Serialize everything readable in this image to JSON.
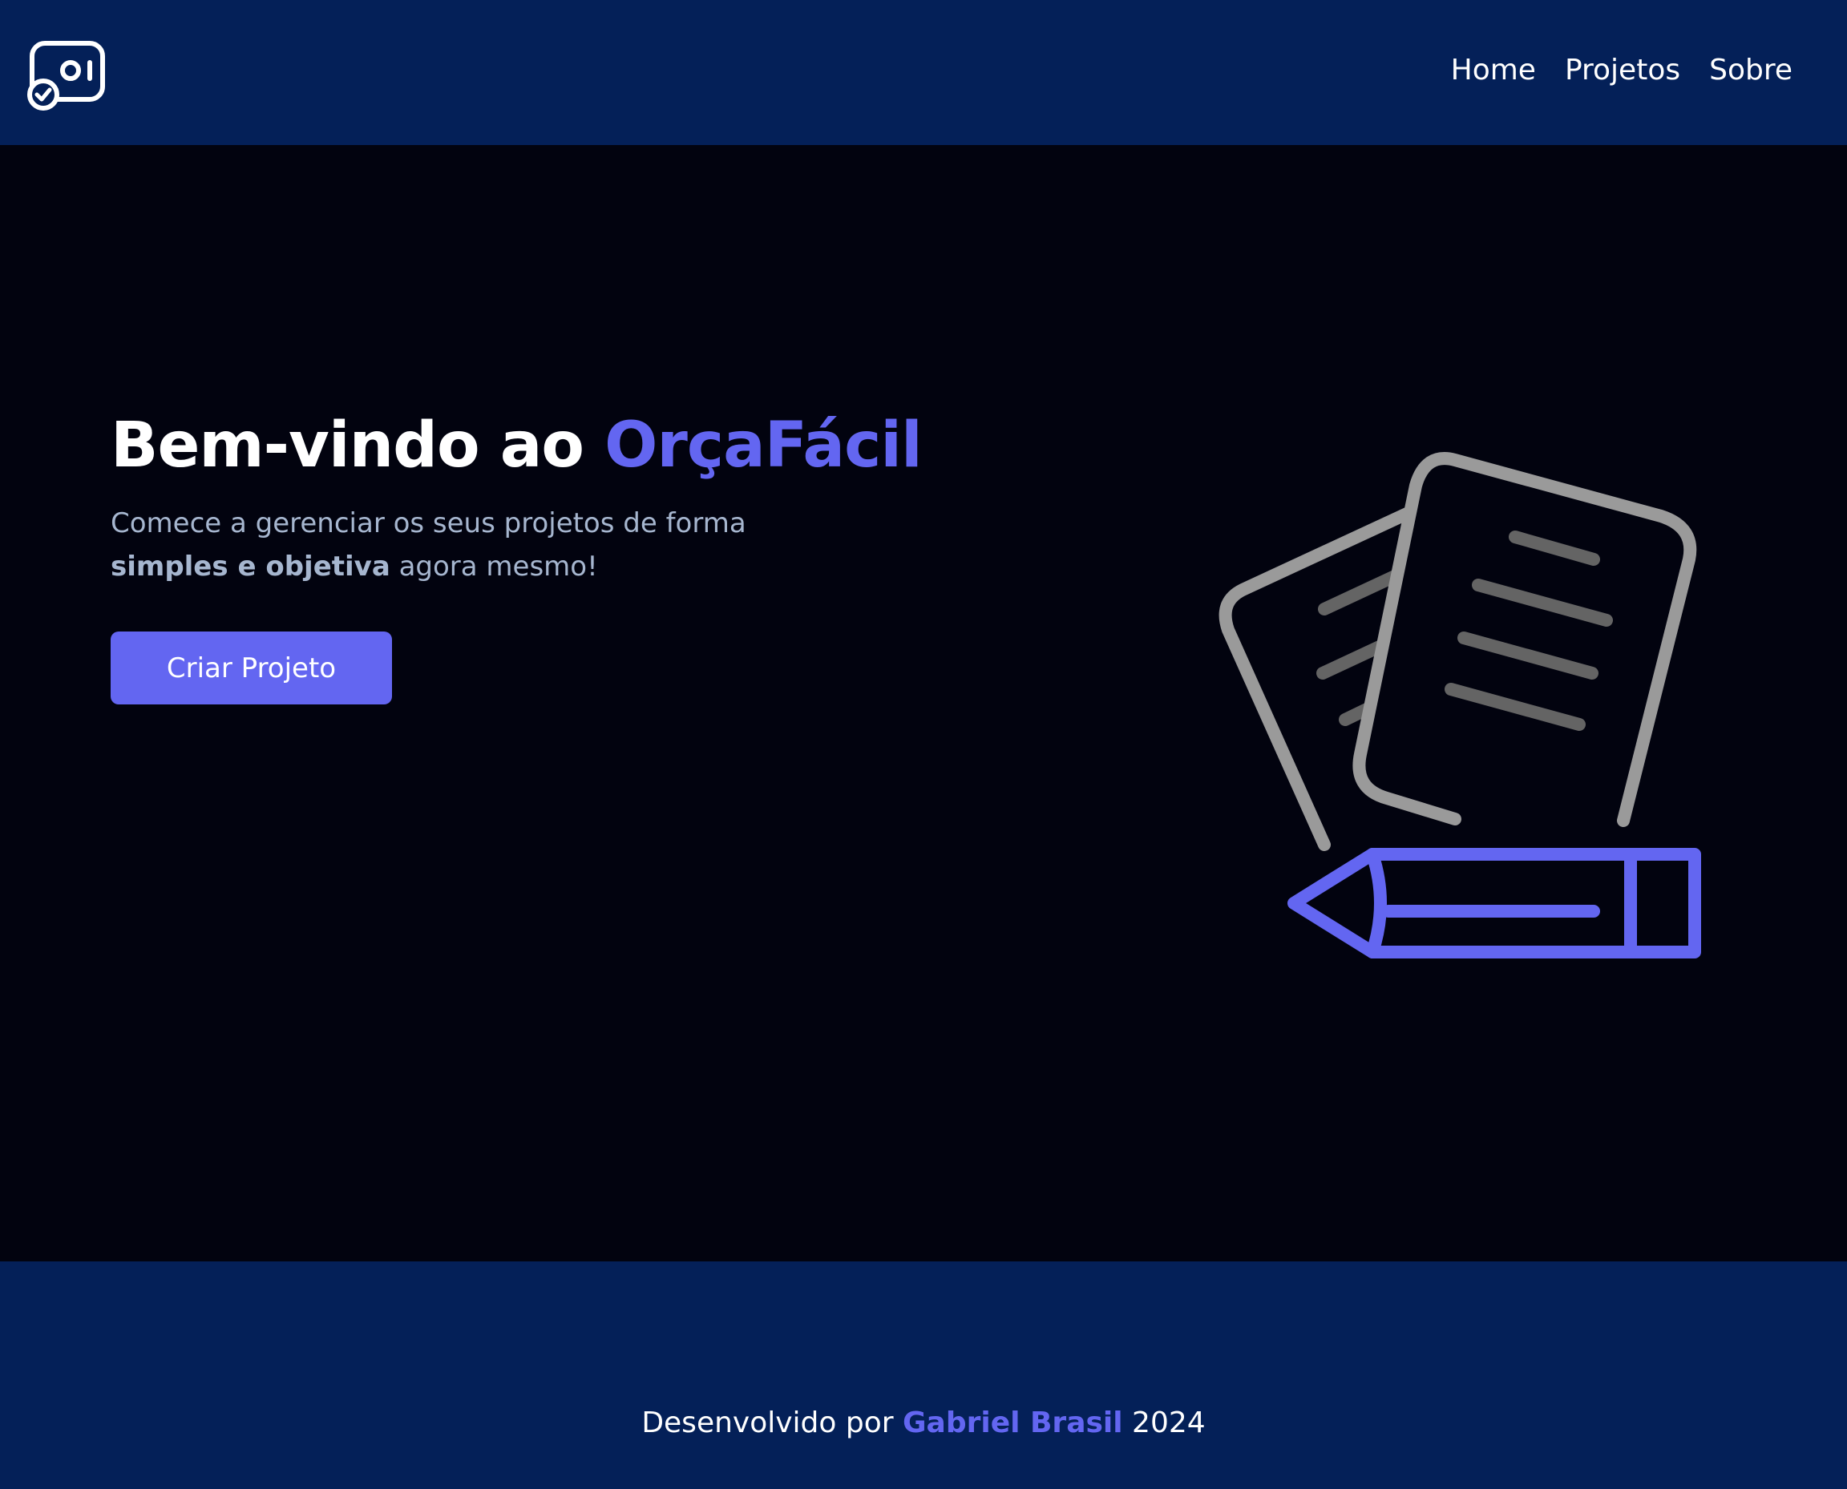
{
  "nav": {
    "logo_icon": "budget-check-icon",
    "links": [
      {
        "label": "Home"
      },
      {
        "label": "Projetos"
      },
      {
        "label": "Sobre"
      }
    ]
  },
  "hero": {
    "title_prefix": "Bem-vindo ao",
    "title_brand": "OrçaFácil",
    "subtitle_line1": "Comece a gerenciar os seus projetos de forma",
    "subtitle_bold": "simples e objetiva",
    "subtitle_rest": "agora mesmo!",
    "cta_label": "Criar Projeto",
    "illustration_icon": "documents-and-pencil-icon"
  },
  "footer": {
    "prefix": "Desenvolvido por",
    "author": "Gabriel Brasil",
    "year": "2024"
  },
  "colors": {
    "navbar_bg": "#042058",
    "page_bg": "#02030f",
    "accent": "#6366f1",
    "subtitle": "#a6b6cf",
    "illustration_gray": "#9a9a9a"
  }
}
